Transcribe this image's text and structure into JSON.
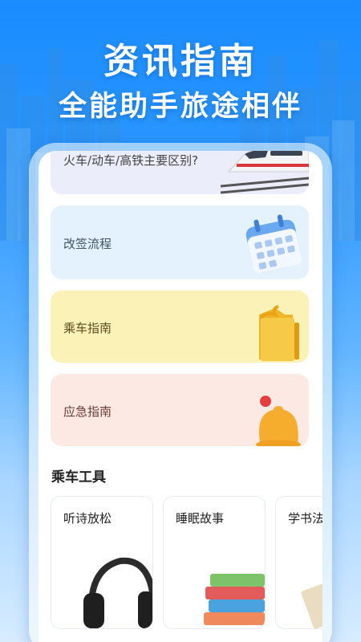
{
  "hero": {
    "title": "资讯指南",
    "subtitle": "全能助手旅途相伴"
  },
  "guide_cards": [
    {
      "label": "火车/动车/高铁主要区别?",
      "icon": "high-speed-train-icon",
      "color": "#ecedfb"
    },
    {
      "label": "改签流程",
      "icon": "calendar-icon",
      "color": "#e4f2fe"
    },
    {
      "label": "乘车指南",
      "icon": "folder-icon",
      "color": "#fbf2b8"
    },
    {
      "label": "应急指南",
      "icon": "bell-icon",
      "color": "#fde9e4"
    }
  ],
  "tools_section": {
    "title": "乘车工具",
    "items": [
      {
        "label": "听诗放松",
        "icon": "headphones-icon"
      },
      {
        "label": "睡眠故事",
        "icon": "books-icon"
      },
      {
        "label": "学书法",
        "icon": "calligraphy-paper-icon"
      }
    ]
  }
}
